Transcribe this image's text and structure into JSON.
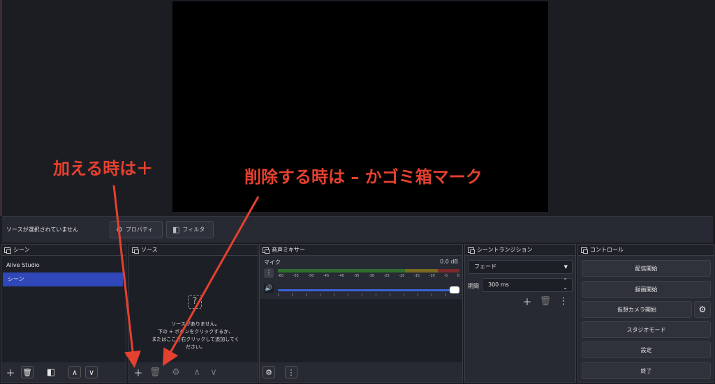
{
  "context_bar": {
    "status": "ソースが選択されていません",
    "properties_label": "プロパティ",
    "filters_label": "フィルタ"
  },
  "scenes": {
    "title": "シーン",
    "items": [
      "Alive Studio",
      "シーン"
    ]
  },
  "sources": {
    "title": "ソース",
    "empty_line1": "ソースがありません。",
    "empty_line2": "下の + ボタンをクリックするか、",
    "empty_line3": "またはここを右クリックして追加してください。"
  },
  "mixer": {
    "title": "音声ミキサー",
    "track_name": "マイク",
    "track_level": "0.0 dB",
    "scale": [
      "-60",
      "-55",
      "-50",
      "-45",
      "-40",
      "-35",
      "-30",
      "-25",
      "-20",
      "-15",
      "-10",
      "-5",
      "0"
    ],
    "volume_fraction": 1.0
  },
  "transitions": {
    "title": "シーントランジション",
    "selected": "フェード",
    "duration_label": "期間",
    "duration_value": "300 ms"
  },
  "controls": {
    "title": "コントロール",
    "start_streaming": "配信開始",
    "start_recording": "録画開始",
    "virtual_camera": "仮想カメラ開始",
    "studio_mode": "スタジオモード",
    "settings": "設定",
    "exit": "終了"
  },
  "annotations": {
    "add_note": "加える時は＋",
    "delete_note": "削除する時は – かゴミ箱マーク",
    "color": "#e5412f"
  }
}
